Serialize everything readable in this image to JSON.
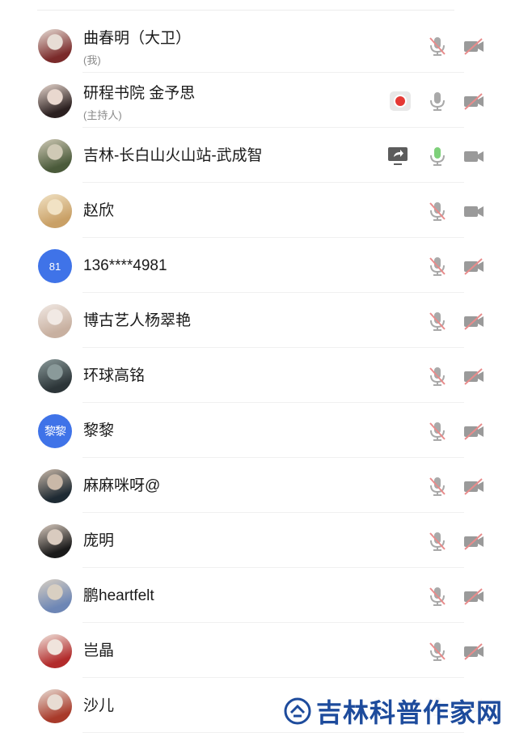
{
  "participants": [
    {
      "name": "曲春明（大卫）",
      "role": "(我)",
      "avatar": {
        "type": "photo",
        "colors": [
          "#7a2a2a",
          "#e7ddd5"
        ]
      },
      "mic": "muted",
      "camera": "off"
    },
    {
      "name": "研程书院 金予思",
      "role": "(主持人)",
      "avatar": {
        "type": "photo",
        "colors": [
          "#2b2020",
          "#e9d8cf"
        ]
      },
      "recording": true,
      "mic": "idle",
      "camera": "off"
    },
    {
      "name": "吉林-长白山火山站-武成智",
      "role": "",
      "avatar": {
        "type": "photo",
        "colors": [
          "#4a5a3a",
          "#cfc9b5"
        ]
      },
      "screen_share": true,
      "mic": "speaking",
      "camera": "on"
    },
    {
      "name": "赵欣",
      "role": "",
      "avatar": {
        "type": "photo",
        "colors": [
          "#c9a066",
          "#f1e2c4"
        ]
      },
      "mic": "muted",
      "camera": "on"
    },
    {
      "name": "136****4981",
      "role": "",
      "avatar": {
        "type": "initial",
        "text": "81",
        "color": "#3f73e8"
      },
      "mic": "muted",
      "camera": "off"
    },
    {
      "name": "博古艺人杨翠艳",
      "role": "",
      "avatar": {
        "type": "photo",
        "colors": [
          "#c8b0a0",
          "#f1e9e4"
        ]
      },
      "mic": "muted",
      "camera": "off"
    },
    {
      "name": "环球高铭",
      "role": "",
      "avatar": {
        "type": "photo",
        "colors": [
          "#2c3538",
          "#8a9a9a"
        ]
      },
      "mic": "muted",
      "camera": "off"
    },
    {
      "name": "黎黎",
      "role": "",
      "avatar": {
        "type": "initial",
        "text": "黎黎",
        "color": "#3f73e8"
      },
      "mic": "muted",
      "camera": "off"
    },
    {
      "name": "麻麻咪呀@",
      "role": "",
      "avatar": {
        "type": "photo",
        "colors": [
          "#1e2a33",
          "#c9b8a8"
        ]
      },
      "mic": "muted",
      "camera": "off"
    },
    {
      "name": "庞明",
      "role": "",
      "avatar": {
        "type": "photo",
        "colors": [
          "#1a1a1a",
          "#d9cbbf"
        ]
      },
      "mic": "muted",
      "camera": "off"
    },
    {
      "name": "鹏heartfelt",
      "role": "",
      "avatar": {
        "type": "photo",
        "colors": [
          "#6d86b5",
          "#d8cfc2"
        ]
      },
      "mic": "muted",
      "camera": "off"
    },
    {
      "name": "岂晶",
      "role": "",
      "avatar": {
        "type": "photo",
        "colors": [
          "#b22b2b",
          "#f0e4dc"
        ]
      },
      "mic": "muted",
      "camera": "off"
    },
    {
      "name": "沙儿",
      "role": "",
      "avatar": {
        "type": "photo",
        "colors": [
          "#a83a2a",
          "#e8dcd3"
        ]
      },
      "mic": "muted",
      "camera": "off"
    }
  ],
  "icons": {
    "mic_muted": "mic-muted-icon",
    "mic_idle": "mic-icon",
    "mic_speaking": "mic-speaking-icon",
    "camera_off": "camera-off-icon",
    "camera_on": "camera-icon",
    "recording": "recording-icon",
    "screen_share": "screen-share-icon"
  },
  "colors": {
    "icon_gray": "#a9a9a9",
    "icon_dark": "#9a9a9a",
    "muted_slash": "#e98b8b",
    "speaking": "#7ed07a",
    "recording": "#e53935",
    "avatar_initial_bg": "#3f73e8",
    "watermark": "#1d4b9c"
  },
  "watermark": {
    "text": "吉林科普作家网"
  }
}
